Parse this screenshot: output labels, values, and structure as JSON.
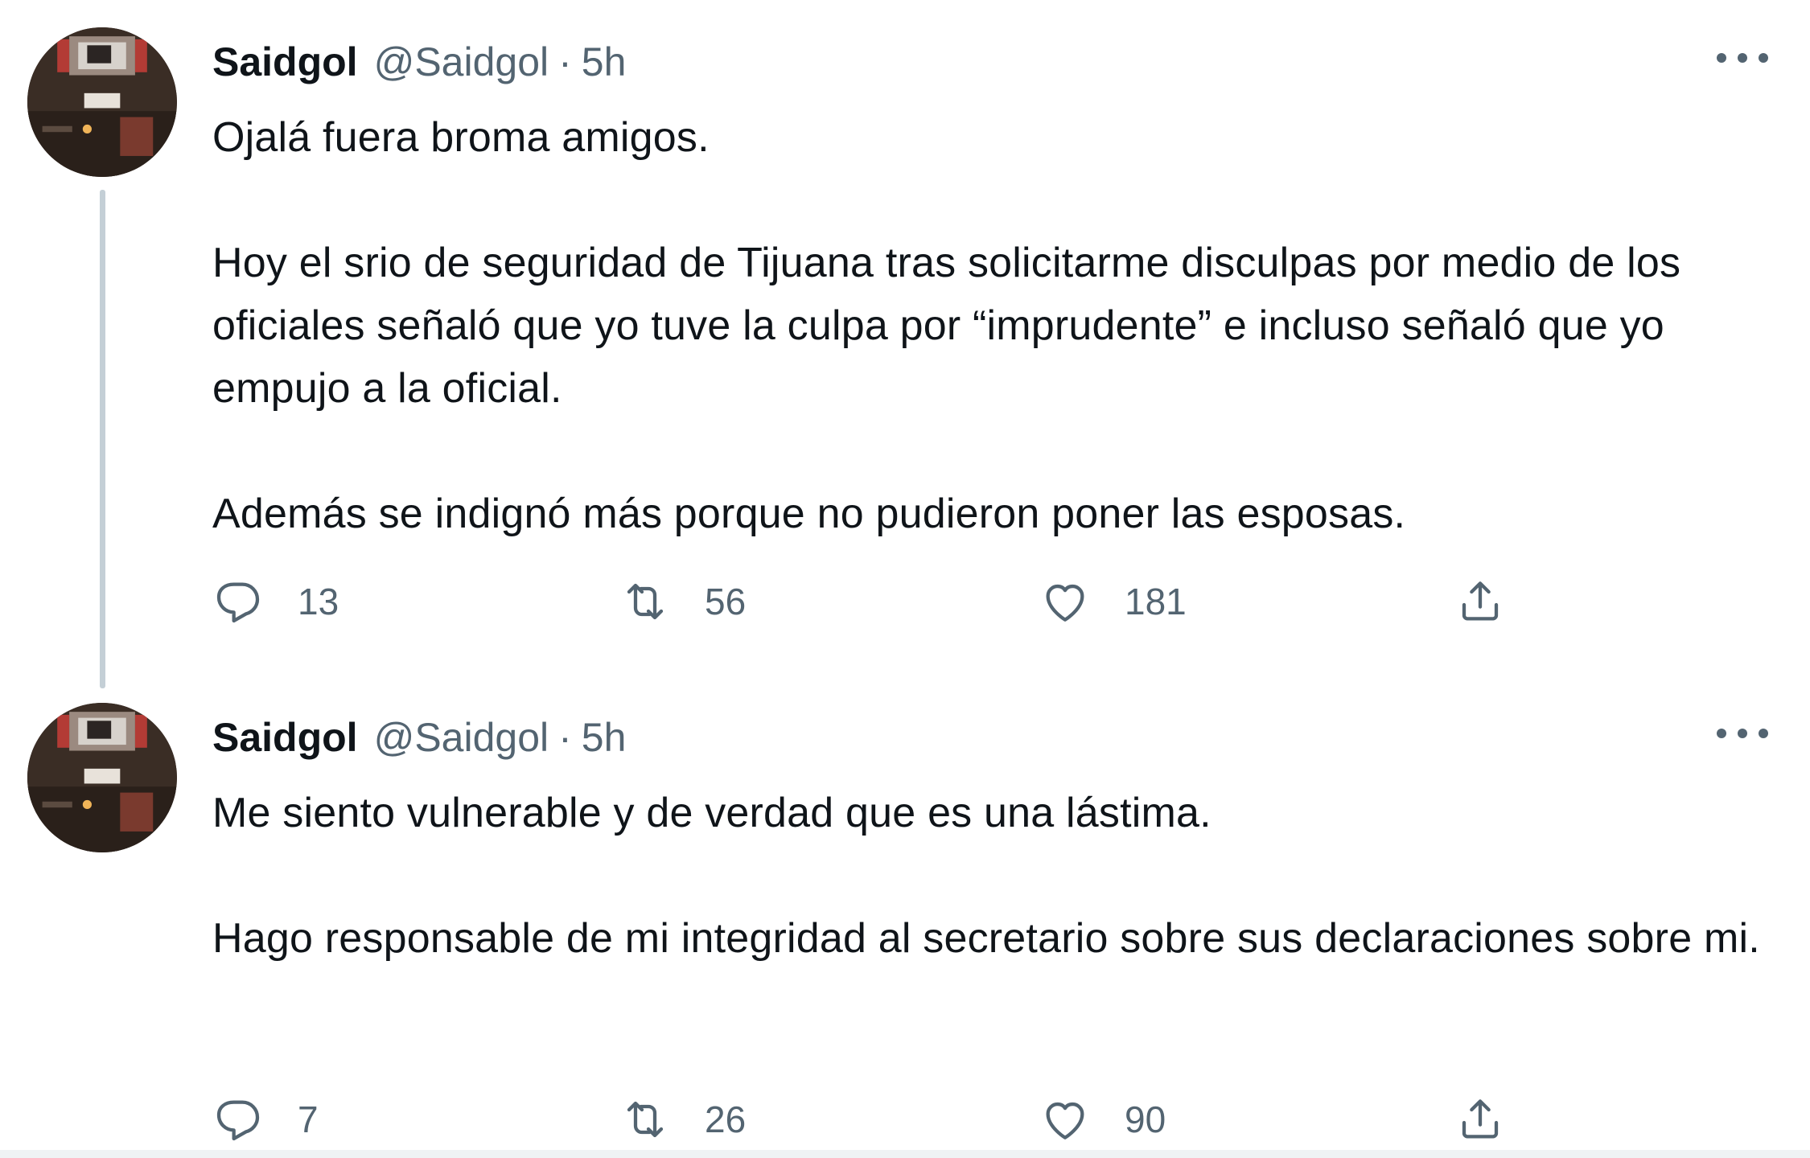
{
  "tweets": [
    {
      "display_name": "Saidgol",
      "handle": "@Saidgol",
      "separator": "·",
      "time": "5h",
      "text": "Ojalá fuera broma amigos.\n\nHoy el srio de seguridad de Tijuana tras solicitarme disculpas por medio de los oficiales señaló que yo tuve la culpa por “imprudente” e incluso señaló que yo empujo a la oficial.\n\nAdemás se indignó más porque no pudieron poner las esposas.",
      "replies": "13",
      "retweets": "56",
      "likes": "181"
    },
    {
      "display_name": "Saidgol",
      "handle": "@Saidgol",
      "separator": "·",
      "time": "5h",
      "text": "Me siento vulnerable y de verdad que es una lástima.\n\nHago responsable de mi integridad al secretario sobre sus declaraciones sobre mi.",
      "replies": "7",
      "retweets": "26",
      "likes": "90"
    }
  ],
  "icons": {
    "reply": "reply-icon",
    "retweet": "retweet-icon",
    "like": "heart-icon",
    "share": "share-icon",
    "more": "more-icon"
  },
  "colors": {
    "text_primary": "#0f1419",
    "text_secondary": "#536471",
    "thread_line": "#c4cfd6"
  }
}
